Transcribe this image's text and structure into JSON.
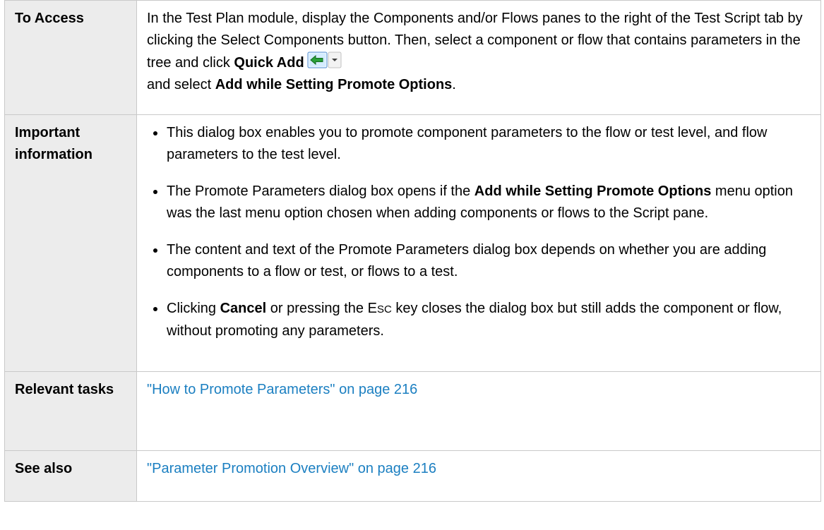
{
  "rows": {
    "access": {
      "head": "To Access",
      "text_1": "In the Test Plan module, display the Components and/or Flows panes to the right of the Test Script tab by clicking the Select Components button. Then, select a component or flow that contains parameters in the tree and click ",
      "bold_1": "Quick Add",
      "text_2": "and select ",
      "bold_2": "Add while Setting Promote Options",
      "text_3": ".",
      "icon": "quick-add-icon"
    },
    "important": {
      "head": "Important information",
      "bullet_1": "This dialog box enables you to promote component parameters to the flow or test level, and flow parameters to the test level.",
      "bullet_2_pre": "The Promote Parameters dialog box opens if the ",
      "bullet_2_bold": "Add while Setting Promote Options",
      "bullet_2_post": " menu option was the last menu option chosen when adding components or flows to the Script pane.",
      "bullet_3": "The content and text of the Promote Parameters dialog box depends on whether you are adding components to a flow or test, or flows to a test.",
      "bullet_4_pre": "Clicking ",
      "bullet_4_bold": "Cancel",
      "bullet_4_mid": " or pressing the ",
      "bullet_4_key_first": "E",
      "bullet_4_key_rest": "SC",
      "bullet_4_post": " key closes the dialog box but still adds the component or flow, without promoting any parameters."
    },
    "tasks": {
      "head": "Relevant tasks",
      "link": "\"How to Promote Parameters\" on page 216"
    },
    "see_also": {
      "head": "See also",
      "link": "\"Parameter Promotion Overview\" on page 216"
    }
  },
  "colors": {
    "header_bg": "#ececec",
    "border": "#c9c9c9",
    "link": "#1b7fc1"
  }
}
